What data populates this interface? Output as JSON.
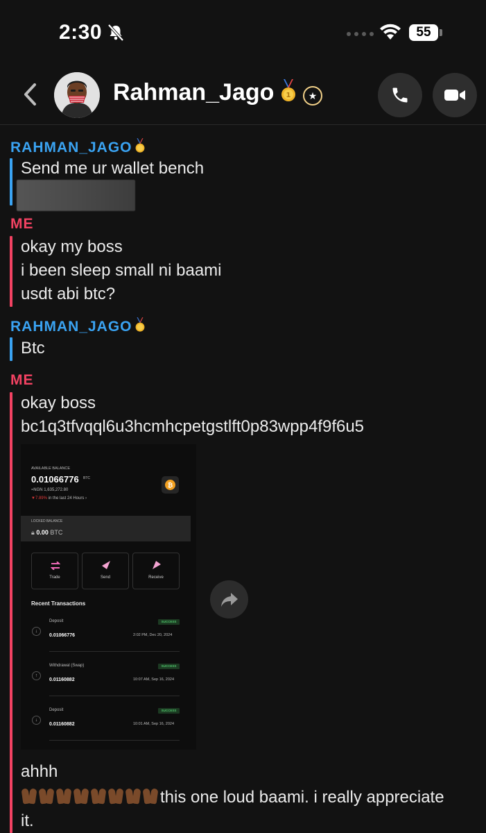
{
  "status_bar": {
    "time": "2:30",
    "battery": "55"
  },
  "header": {
    "contact_name": "Rahman_Jago"
  },
  "messages": [
    {
      "sender": "RAHMAN_JAGO",
      "side": "them",
      "lines": [
        "Send me ur wallet bench"
      ]
    },
    {
      "sender": "ME",
      "side": "me",
      "lines": [
        "okay my boss",
        "i been sleep small ni baami",
        "usdt abi btc?"
      ]
    },
    {
      "sender": "RAHMAN_JAGO",
      "side": "them",
      "lines": [
        "Btc"
      ]
    },
    {
      "sender": "ME",
      "side": "me",
      "lines": [
        "okay boss",
        "bc1q3tfvqql6u3hcmhcpetgstlft0p83wpp4f9f6u5"
      ]
    },
    {
      "lines": [
        "ahhh",
        "this one loud baami. i really appreciate",
        "it."
      ]
    }
  ],
  "wallet_screenshot": {
    "available_label": "AVAILABLE BALANCE",
    "balance": "0.01066776",
    "balance_unit": "BTC",
    "fiat": "≈NGN 1,635,272.80",
    "change_pct": "7.89%",
    "change_text": "in the last 24 Hours",
    "locked_label": "LOCKED BALANCE",
    "locked_value": "0.00",
    "locked_unit": "BTC",
    "actions": [
      "Trade",
      "Send",
      "Receive"
    ],
    "recent_title": "Recent Transactions",
    "transactions": [
      {
        "type": "Deposit",
        "amount": "0.01066776",
        "status": "SUCCESS",
        "date": "2:02 PM, Dec 20, 2024"
      },
      {
        "type": "Withdrawal (Swap)",
        "amount": "0.01160882",
        "status": "SUCCESS",
        "date": "10:07 AM, Sep 16, 2024"
      },
      {
        "type": "Deposit",
        "amount": "0.01160882",
        "status": "SUCCESS",
        "date": "10:01 AM, Sep 16, 2024"
      }
    ]
  },
  "colors": {
    "them": "#3aa3f2",
    "me": "#f24262",
    "background": "#121212"
  }
}
